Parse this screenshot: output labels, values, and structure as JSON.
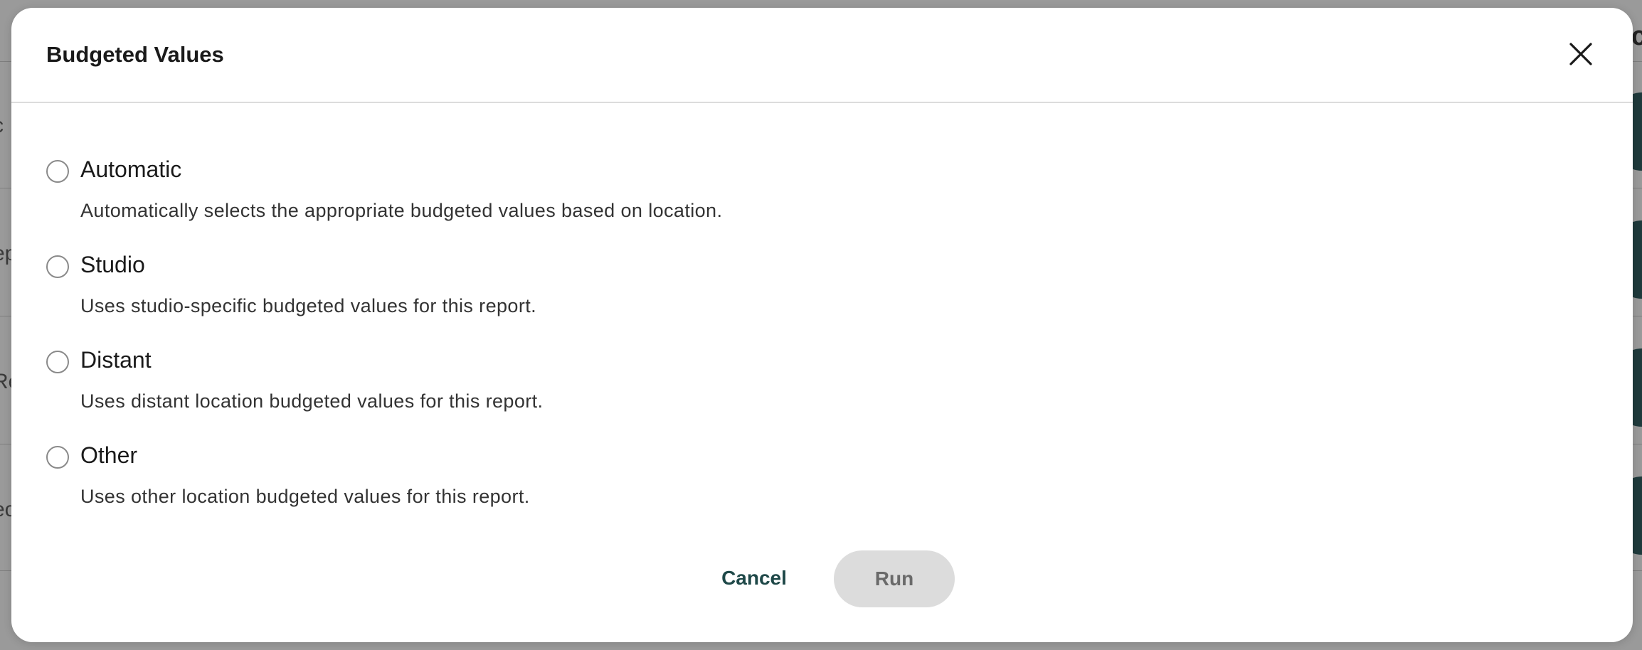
{
  "dialog": {
    "title": "Budgeted Values",
    "close_icon": "close-icon"
  },
  "options": [
    {
      "label": "Automatic",
      "description": "Automatically selects the appropriate budgeted values based on location.",
      "selected": false
    },
    {
      "label": "Studio",
      "description": "Uses studio-specific budgeted values for this report.",
      "selected": false
    },
    {
      "label": "Distant",
      "description": "Uses distant location budgeted values for this report.",
      "selected": false
    },
    {
      "label": "Other",
      "description": "Uses other location budgeted values for this report.",
      "selected": false
    }
  ],
  "actions": {
    "cancel_label": "Cancel",
    "run_label": "Run",
    "run_enabled": false
  },
  "background": {
    "fragments": [
      "c",
      "ep",
      "Re",
      "ec"
    ],
    "corner_text": "Ac"
  },
  "colors": {
    "accent": "#1e4848",
    "disabled_bg": "#dcdcdc",
    "backdrop": "#8a8a8a"
  }
}
